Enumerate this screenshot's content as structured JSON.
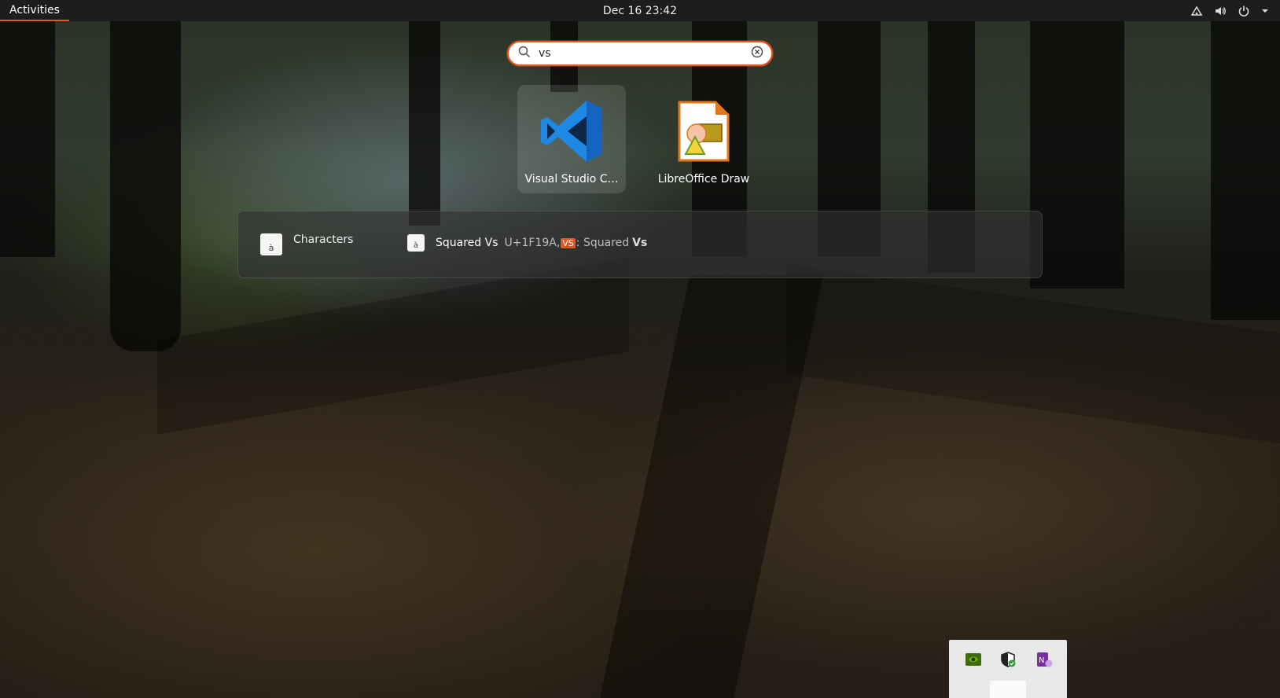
{
  "topbar": {
    "activities_label": "Activities",
    "clock": "Dec 16  23:42",
    "tray_icons": [
      "network-icon",
      "volume-icon",
      "power-icon",
      "menu-arrow-icon"
    ]
  },
  "search": {
    "query": "vs",
    "icon": "search-icon",
    "clear_icon": "clear-icon"
  },
  "apps": [
    {
      "label": "Visual Studio C…",
      "icon": "vscode-icon",
      "selected": true
    },
    {
      "label": "LibreOffice Draw",
      "icon": "libreoffice-draw-icon",
      "selected": false
    }
  ],
  "providers": [
    {
      "name": "Characters",
      "icon_glyph": "à",
      "results": [
        {
          "icon_glyph": "à",
          "title": "Squared Vs",
          "desc_code": "U+1F19A,",
          "desc_symbol": "VS",
          "desc_text": ": Squared",
          "desc_bold": "Vs"
        }
      ]
    }
  ],
  "colors": {
    "accent": "#e95420",
    "topbar": "#1d1d1d",
    "vscode_blue": "#1e88e5"
  }
}
